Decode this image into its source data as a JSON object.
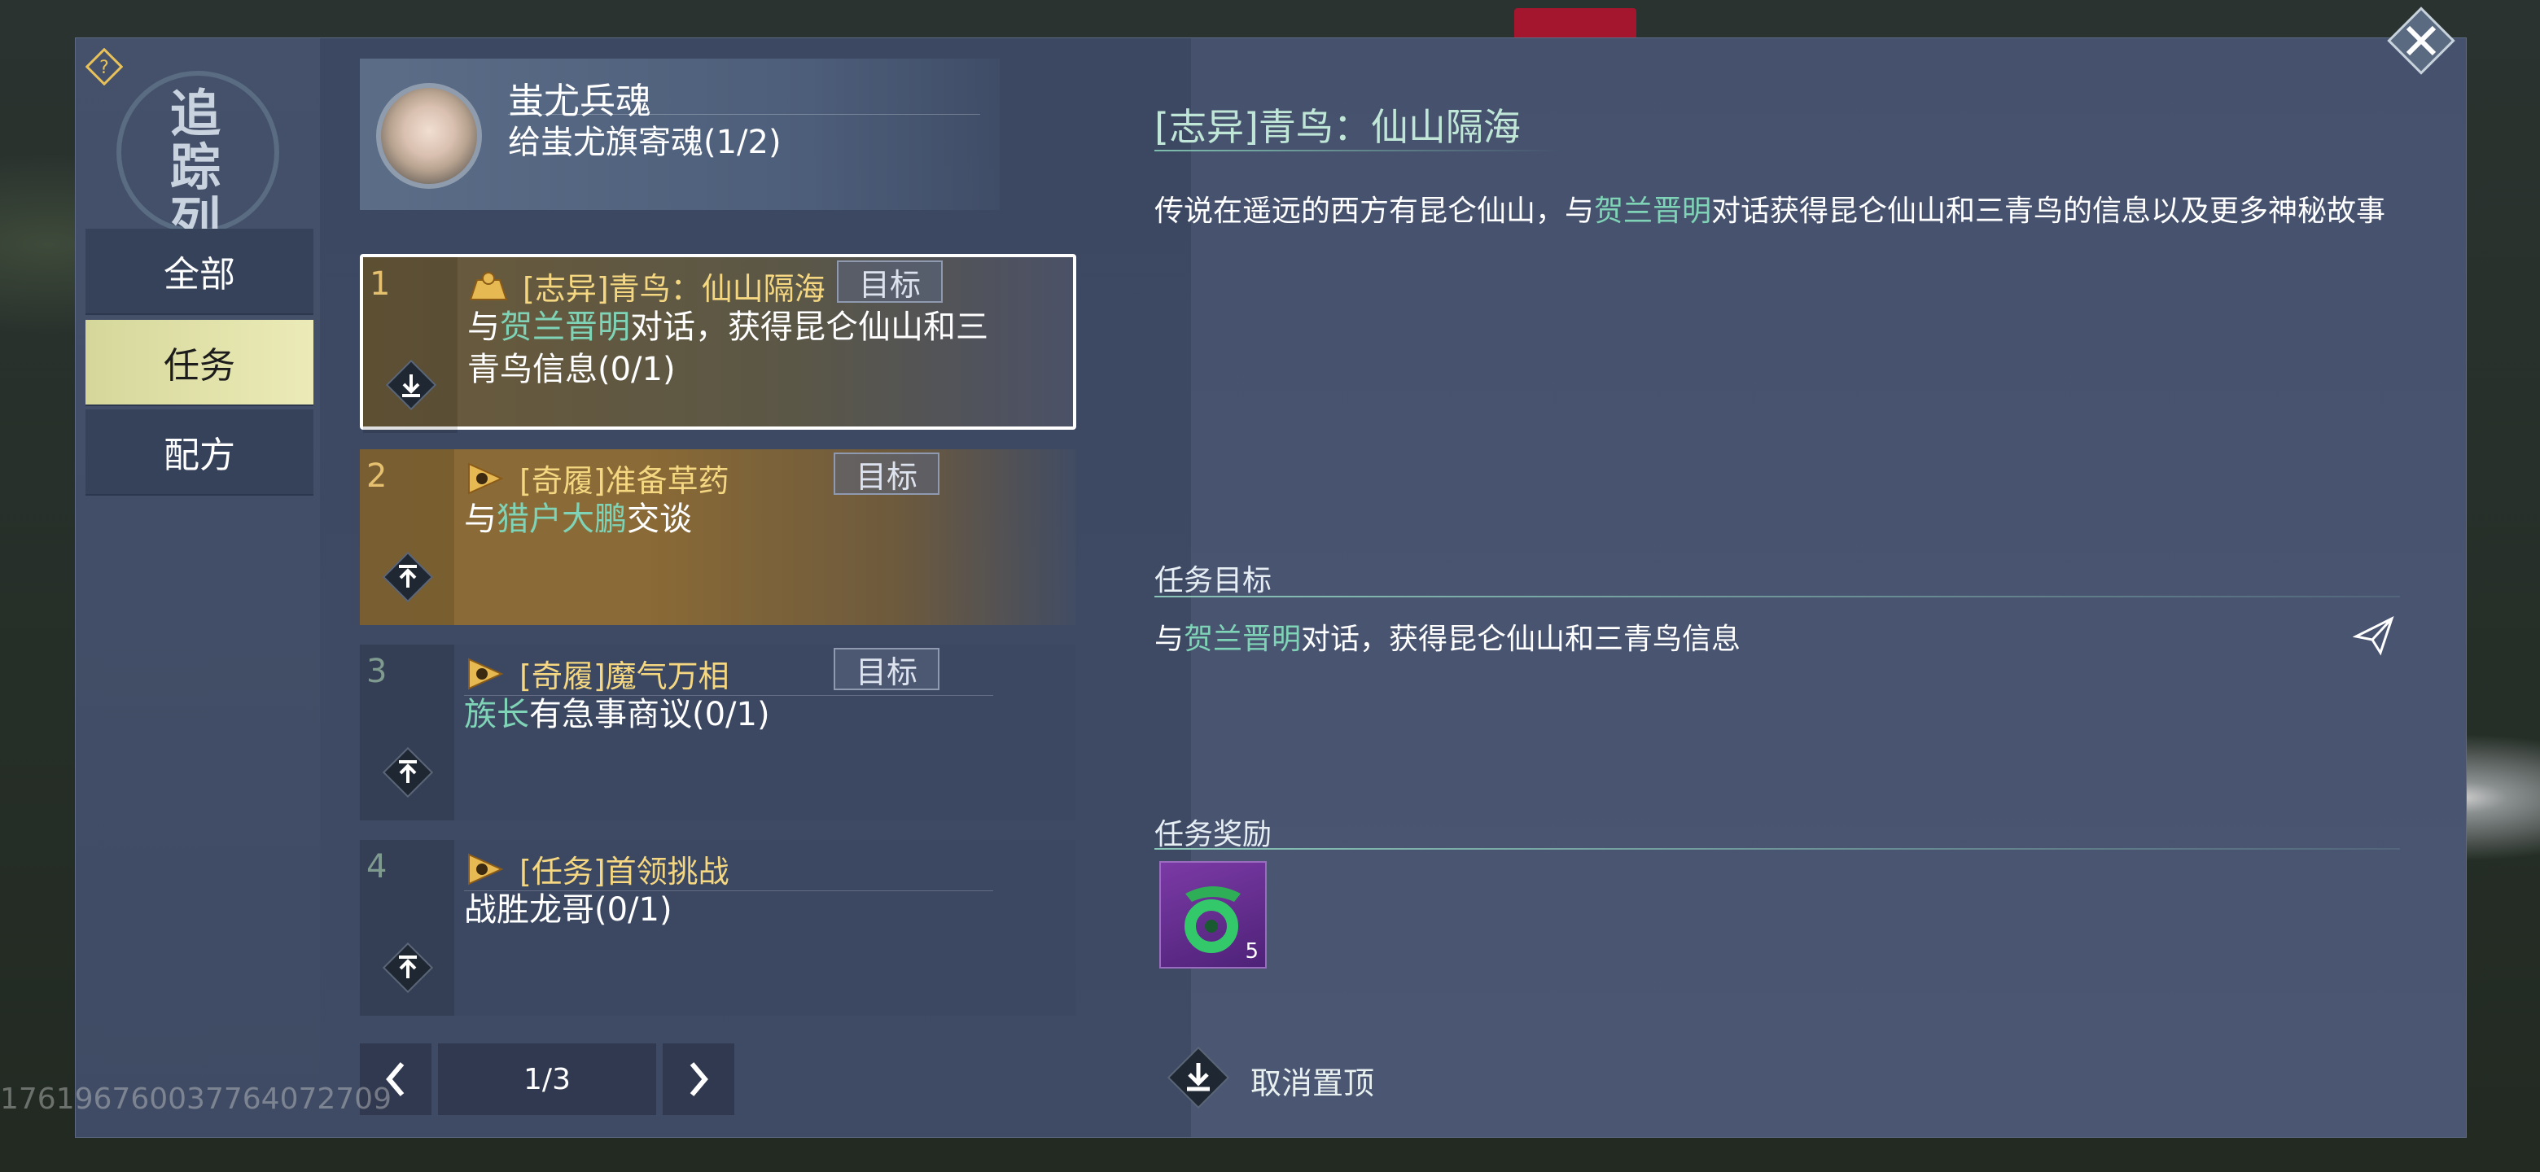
{
  "side": {
    "emblem_text": "追踪\n列表",
    "categories": [
      {
        "label": "全部",
        "active": false
      },
      {
        "label": "任务",
        "active": true
      },
      {
        "label": "配方",
        "active": false
      }
    ]
  },
  "pinned": {
    "title": "蚩尤兵魂",
    "subtitle": "给蚩尤旗寄魂(1/2)"
  },
  "quests": [
    {
      "num": "1",
      "title": "[志异]青鸟：仙山隔海",
      "target_label": "目标",
      "desc_pre": "与",
      "desc_hl": "贺兰晋明",
      "desc_post": "对话，获得昆仑仙山和三青鸟信息(0/1)",
      "pin": "down-pin-icon"
    },
    {
      "num": "2",
      "title": "[奇履]准备草药",
      "target_label": "目标",
      "desc_pre": "与",
      "desc_hl": "猎户大鹏",
      "desc_post": "交谈",
      "pin": "up-pin-icon"
    },
    {
      "num": "3",
      "title": "[奇履]魔气万相",
      "target_label": "目标",
      "desc_pre": "",
      "desc_hl": "族长",
      "desc_post": "有急事商议(0/1)",
      "pin": "up-pin-icon"
    },
    {
      "num": "4",
      "title": "[任务]首领挑战",
      "target_label": "",
      "desc_pre": "",
      "desc_hl": "",
      "desc_post": "战胜龙哥(0/1)",
      "pin": "up-pin-icon"
    }
  ],
  "pager": {
    "label": "1/3"
  },
  "detail": {
    "title": "[志异]青鸟：仙山隔海",
    "desc_pre": "传说在遥远的西方有昆仑仙山，与",
    "desc_hl": "贺兰晋明",
    "desc_post": "对话获得昆仑仙山和三青鸟的信息以及更多神秘故事",
    "goal_section": "任务目标",
    "goal_pre": "与",
    "goal_hl": "贺兰晋明",
    "goal_post": "对话，获得昆仑仙山和三青鸟信息",
    "reward_section": "任务奖励",
    "reward_count": "5",
    "unpin_label": "取消置顶"
  },
  "watermark": "1761967600377640727​09",
  "colors": {
    "highlight": "#7fd3b6",
    "quest_title": "#f4d780",
    "active_tab": "#e4e3ac"
  }
}
